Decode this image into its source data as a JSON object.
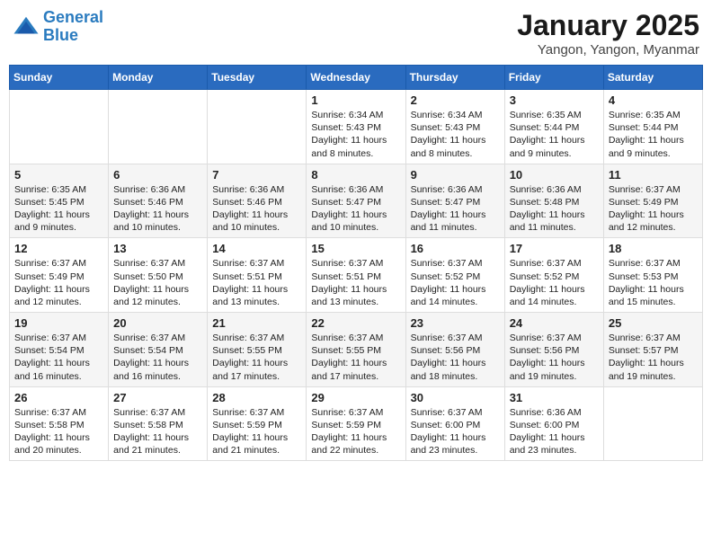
{
  "logo": {
    "line1": "General",
    "line2": "Blue"
  },
  "title": "January 2025",
  "location": "Yangon, Yangon, Myanmar",
  "weekdays": [
    "Sunday",
    "Monday",
    "Tuesday",
    "Wednesday",
    "Thursday",
    "Friday",
    "Saturday"
  ],
  "weeks": [
    [
      {
        "day": "",
        "info": ""
      },
      {
        "day": "",
        "info": ""
      },
      {
        "day": "",
        "info": ""
      },
      {
        "day": "1",
        "info": "Sunrise: 6:34 AM\nSunset: 5:43 PM\nDaylight: 11 hours\nand 8 minutes."
      },
      {
        "day": "2",
        "info": "Sunrise: 6:34 AM\nSunset: 5:43 PM\nDaylight: 11 hours\nand 8 minutes."
      },
      {
        "day": "3",
        "info": "Sunrise: 6:35 AM\nSunset: 5:44 PM\nDaylight: 11 hours\nand 9 minutes."
      },
      {
        "day": "4",
        "info": "Sunrise: 6:35 AM\nSunset: 5:44 PM\nDaylight: 11 hours\nand 9 minutes."
      }
    ],
    [
      {
        "day": "5",
        "info": "Sunrise: 6:35 AM\nSunset: 5:45 PM\nDaylight: 11 hours\nand 9 minutes."
      },
      {
        "day": "6",
        "info": "Sunrise: 6:36 AM\nSunset: 5:46 PM\nDaylight: 11 hours\nand 10 minutes."
      },
      {
        "day": "7",
        "info": "Sunrise: 6:36 AM\nSunset: 5:46 PM\nDaylight: 11 hours\nand 10 minutes."
      },
      {
        "day": "8",
        "info": "Sunrise: 6:36 AM\nSunset: 5:47 PM\nDaylight: 11 hours\nand 10 minutes."
      },
      {
        "day": "9",
        "info": "Sunrise: 6:36 AM\nSunset: 5:47 PM\nDaylight: 11 hours\nand 11 minutes."
      },
      {
        "day": "10",
        "info": "Sunrise: 6:36 AM\nSunset: 5:48 PM\nDaylight: 11 hours\nand 11 minutes."
      },
      {
        "day": "11",
        "info": "Sunrise: 6:37 AM\nSunset: 5:49 PM\nDaylight: 11 hours\nand 12 minutes."
      }
    ],
    [
      {
        "day": "12",
        "info": "Sunrise: 6:37 AM\nSunset: 5:49 PM\nDaylight: 11 hours\nand 12 minutes."
      },
      {
        "day": "13",
        "info": "Sunrise: 6:37 AM\nSunset: 5:50 PM\nDaylight: 11 hours\nand 12 minutes."
      },
      {
        "day": "14",
        "info": "Sunrise: 6:37 AM\nSunset: 5:51 PM\nDaylight: 11 hours\nand 13 minutes."
      },
      {
        "day": "15",
        "info": "Sunrise: 6:37 AM\nSunset: 5:51 PM\nDaylight: 11 hours\nand 13 minutes."
      },
      {
        "day": "16",
        "info": "Sunrise: 6:37 AM\nSunset: 5:52 PM\nDaylight: 11 hours\nand 14 minutes."
      },
      {
        "day": "17",
        "info": "Sunrise: 6:37 AM\nSunset: 5:52 PM\nDaylight: 11 hours\nand 14 minutes."
      },
      {
        "day": "18",
        "info": "Sunrise: 6:37 AM\nSunset: 5:53 PM\nDaylight: 11 hours\nand 15 minutes."
      }
    ],
    [
      {
        "day": "19",
        "info": "Sunrise: 6:37 AM\nSunset: 5:54 PM\nDaylight: 11 hours\nand 16 minutes."
      },
      {
        "day": "20",
        "info": "Sunrise: 6:37 AM\nSunset: 5:54 PM\nDaylight: 11 hours\nand 16 minutes."
      },
      {
        "day": "21",
        "info": "Sunrise: 6:37 AM\nSunset: 5:55 PM\nDaylight: 11 hours\nand 17 minutes."
      },
      {
        "day": "22",
        "info": "Sunrise: 6:37 AM\nSunset: 5:55 PM\nDaylight: 11 hours\nand 17 minutes."
      },
      {
        "day": "23",
        "info": "Sunrise: 6:37 AM\nSunset: 5:56 PM\nDaylight: 11 hours\nand 18 minutes."
      },
      {
        "day": "24",
        "info": "Sunrise: 6:37 AM\nSunset: 5:56 PM\nDaylight: 11 hours\nand 19 minutes."
      },
      {
        "day": "25",
        "info": "Sunrise: 6:37 AM\nSunset: 5:57 PM\nDaylight: 11 hours\nand 19 minutes."
      }
    ],
    [
      {
        "day": "26",
        "info": "Sunrise: 6:37 AM\nSunset: 5:58 PM\nDaylight: 11 hours\nand 20 minutes."
      },
      {
        "day": "27",
        "info": "Sunrise: 6:37 AM\nSunset: 5:58 PM\nDaylight: 11 hours\nand 21 minutes."
      },
      {
        "day": "28",
        "info": "Sunrise: 6:37 AM\nSunset: 5:59 PM\nDaylight: 11 hours\nand 21 minutes."
      },
      {
        "day": "29",
        "info": "Sunrise: 6:37 AM\nSunset: 5:59 PM\nDaylight: 11 hours\nand 22 minutes."
      },
      {
        "day": "30",
        "info": "Sunrise: 6:37 AM\nSunset: 6:00 PM\nDaylight: 11 hours\nand 23 minutes."
      },
      {
        "day": "31",
        "info": "Sunrise: 6:36 AM\nSunset: 6:00 PM\nDaylight: 11 hours\nand 23 minutes."
      },
      {
        "day": "",
        "info": ""
      }
    ]
  ]
}
